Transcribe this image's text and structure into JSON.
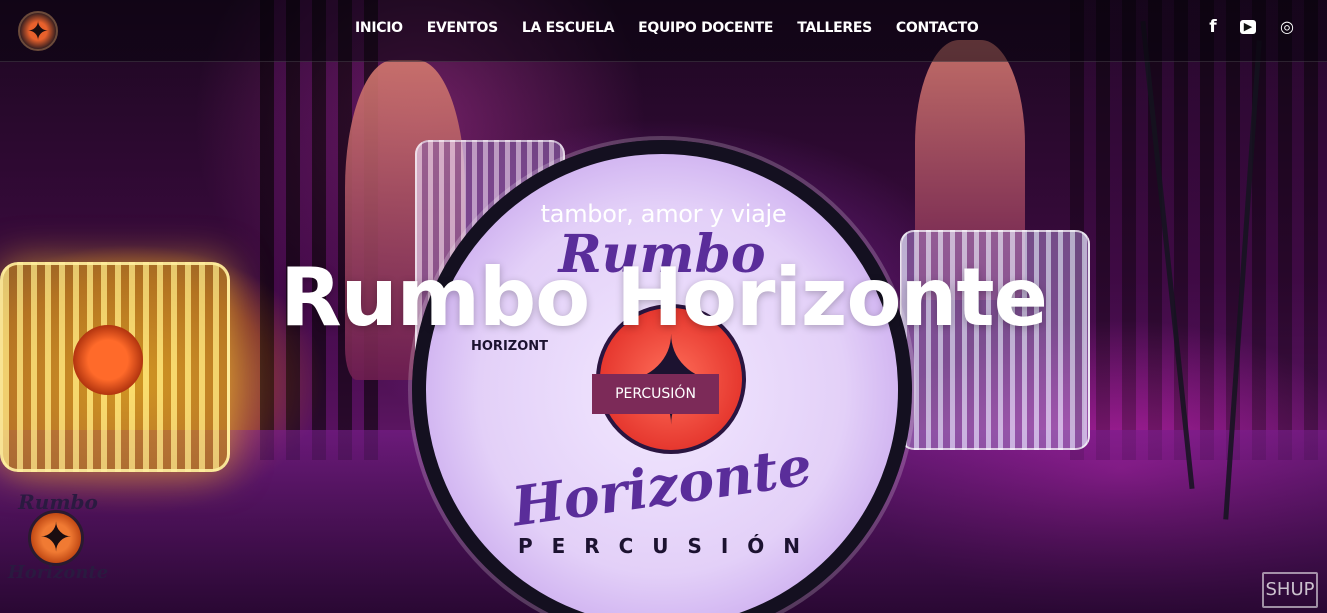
{
  "nav": {
    "items": [
      {
        "label": "INICIO"
      },
      {
        "label": "EVENTOS"
      },
      {
        "label": "LA ESCUELA"
      },
      {
        "label": "EQUIPO DOCENTE"
      },
      {
        "label": "TALLERES"
      },
      {
        "label": "CONTACTO"
      }
    ]
  },
  "social": {
    "facebook": {
      "glyph": "f",
      "icon": "facebook-icon"
    },
    "youtube": {
      "glyph": "▶",
      "icon": "youtube-icon"
    },
    "instagram": {
      "glyph": "◎",
      "icon": "instagram-icon"
    }
  },
  "hero": {
    "tagline": "tambor, amor y viaje",
    "title": "Rumbo Horizonte",
    "cta_label": "PERCUSIÓN"
  },
  "drum_graphic": {
    "top_text": "Rumbo",
    "bottom_text": "Horizonte",
    "ring_text": "P E R C U S I Ó N",
    "small_text": "HORIZONT"
  },
  "corner_logo": {
    "top": "Rumbo",
    "bottom": "Horizonte"
  },
  "watermark": "SHUP",
  "colors": {
    "cta_bg": "#7c2a58",
    "text": "#ffffff"
  }
}
